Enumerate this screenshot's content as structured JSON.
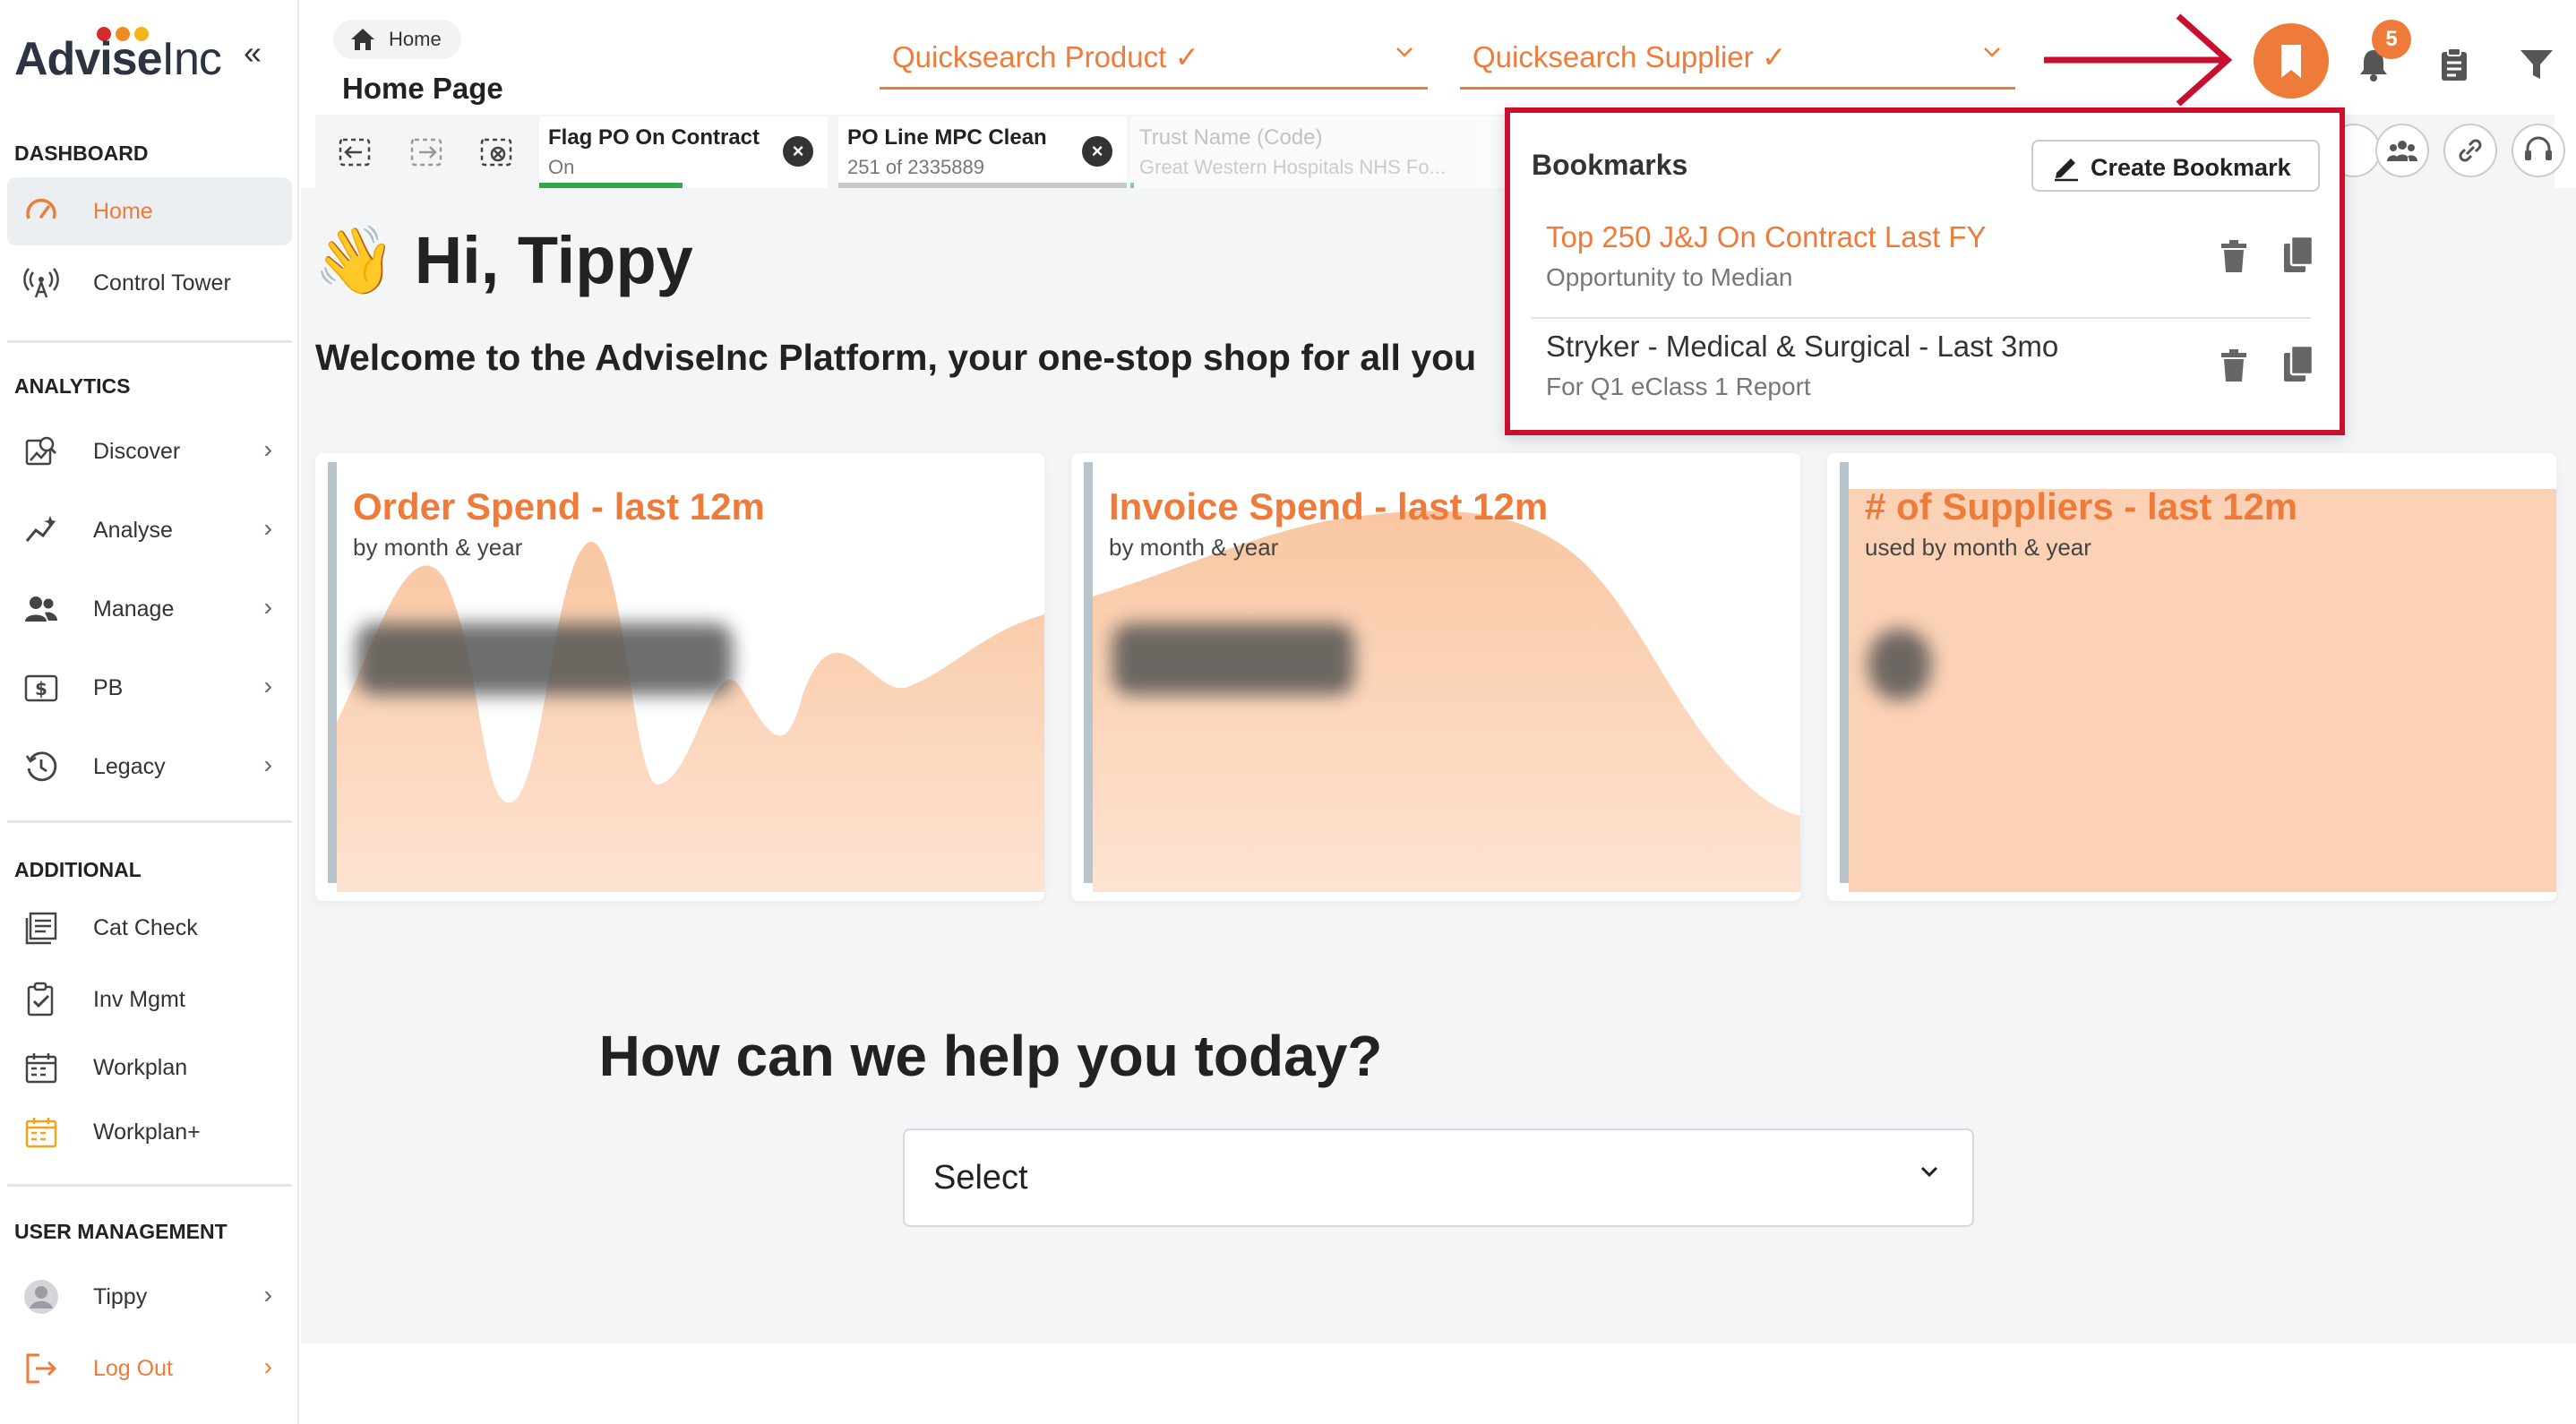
{
  "app": {
    "logo_bold": "Advise",
    "logo_light": "Inc",
    "collapse_glyph": "«"
  },
  "sidebar": {
    "sections": [
      {
        "title": "DASHBOARD"
      },
      {
        "title": "ANALYTICS"
      },
      {
        "title": "ADDITIONAL"
      },
      {
        "title": "USER MANAGEMENT"
      }
    ],
    "items": [
      {
        "label": "Home",
        "icon": "speedometer-icon",
        "active": true
      },
      {
        "label": "Control Tower",
        "icon": "antenna-icon"
      },
      {
        "label": "Discover",
        "icon": "discover-icon"
      },
      {
        "label": "Analyse",
        "icon": "analyse-icon"
      },
      {
        "label": "Manage",
        "icon": "users-icon"
      },
      {
        "label": "PB",
        "icon": "dollar-icon"
      },
      {
        "label": "Legacy",
        "icon": "history-icon"
      },
      {
        "label": "Cat Check",
        "icon": "catalog-icon"
      },
      {
        "label": "Inv Mgmt",
        "icon": "clipboard-check-icon"
      },
      {
        "label": "Workplan",
        "icon": "calendar-icon"
      },
      {
        "label": "Workplan+",
        "icon": "calendar-plus-icon"
      },
      {
        "label": "Tippy",
        "icon": "avatar-icon"
      },
      {
        "label": "Log Out",
        "icon": "logout-icon"
      }
    ],
    "chevron": "›"
  },
  "header": {
    "breadcrumb": "Home",
    "page_title": "Home Page",
    "quicksearch_product": "Quicksearch Product ✓",
    "quicksearch_supplier": "Quicksearch Supplier ✓",
    "notification_count": "5"
  },
  "filters": {
    "chips": [
      {
        "title": "Flag PO On Contract",
        "value": "On"
      },
      {
        "title": "PO Line MPC Clean",
        "value": "251 of 2335889"
      },
      {
        "title": "Trust Name (Code)",
        "value": "Great Western Hospitals NHS Fo..."
      }
    ]
  },
  "main": {
    "greeting": "👋 Hi, Tippy",
    "welcome": "Welcome to the AdviseInc Platform, your one-stop shop for all you",
    "cards": [
      {
        "title": "Order Spend - last 12m",
        "subtitle": "by month & year"
      },
      {
        "title": "Invoice Spend - last 12m",
        "subtitle": "by month & year"
      },
      {
        "title": "# of Suppliers - last 12m",
        "subtitle": "used by month & year"
      }
    ],
    "help_title": "How can we help you today?",
    "select_value": "Select"
  },
  "bookmarks": {
    "title": "Bookmarks",
    "create_label": "Create Bookmark",
    "items": [
      {
        "name": "Top 250 J&J On Contract Last FY",
        "description": "Opportunity to Median",
        "highlight": true
      },
      {
        "name": "Stryker - Medical & Surgical - Last 3mo",
        "description": "For Q1 eClass 1 Report"
      }
    ]
  },
  "colors": {
    "accent": "#ef7b3a",
    "highlight_frame": "#c8102e",
    "chart_fill": "#fbd3b8"
  }
}
